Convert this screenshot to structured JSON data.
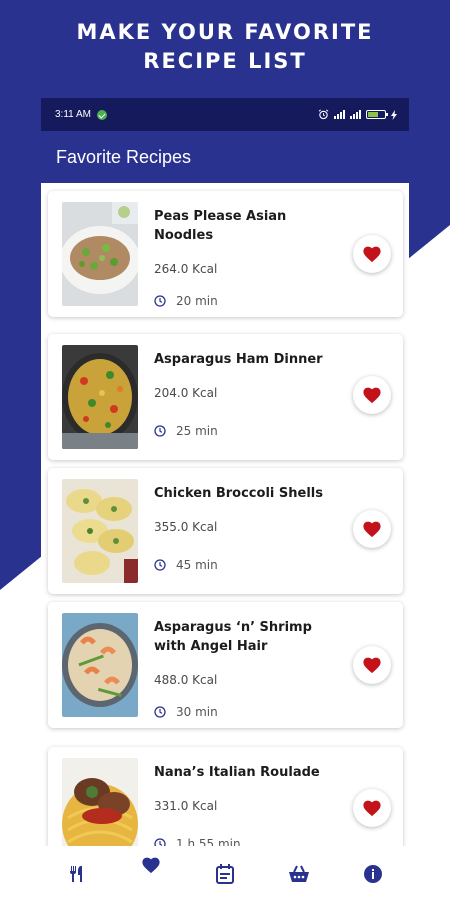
{
  "promo": {
    "line1": "MAKE YOUR FAVORITE",
    "line2": "RECIPE LIST"
  },
  "status_bar": {
    "time": "3:11 AM"
  },
  "app_bar": {
    "title": "Favorite Recipes"
  },
  "recipes": [
    {
      "title": "Peas Please Asian Noodles",
      "kcal": "264.0 Kcal",
      "time": "20 min",
      "favorite": true
    },
    {
      "title": "Asparagus Ham Dinner",
      "kcal": "204.0 Kcal",
      "time": "25 min",
      "favorite": true
    },
    {
      "title": "Chicken Broccoli Shells",
      "kcal": "355.0 Kcal",
      "time": "45 min",
      "favorite": true
    },
    {
      "title": "Asparagus ‘n’ Shrimp with Angel Hair",
      "kcal": "488.0 Kcal",
      "time": "30 min",
      "favorite": true
    },
    {
      "title": "Nana’s Italian Roulade",
      "kcal": "331.0 Kcal",
      "time": "1 h 55 min",
      "favorite": true
    }
  ],
  "bottom_nav": [
    {
      "icon": "utensils-icon",
      "active": false
    },
    {
      "icon": "heart-icon",
      "active": true
    },
    {
      "icon": "calendar-icon",
      "active": false
    },
    {
      "icon": "basket-icon",
      "active": false
    },
    {
      "icon": "info-icon",
      "active": false
    }
  ],
  "colors": {
    "brand_blue": "#2a3290",
    "status_bar": "#141a5c",
    "heart_red": "#c4121a",
    "nav_icon": "#2a3290"
  }
}
